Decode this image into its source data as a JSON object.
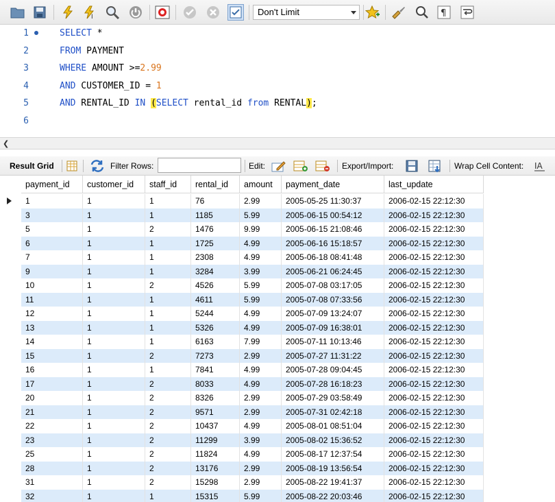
{
  "toolbar": {
    "limit_value": "Don't Limit",
    "icons": [
      "open-folder-icon",
      "save-icon",
      "execute-icon",
      "execute-current-icon",
      "explain-icon",
      "stop-icon",
      "toggle-continue-icon",
      "commit-icon",
      "rollback-icon",
      "autocommit-icon",
      "bookmark-star-icon",
      "beautify-brush-icon",
      "find-icon",
      "invisible-chars-icon",
      "wrap-icon"
    ]
  },
  "editor": {
    "line_numbers": [
      "1",
      "2",
      "3",
      "4",
      "5",
      "6"
    ],
    "lines": [
      [
        {
          "t": "SELECT",
          "c": "kw"
        },
        {
          "t": " *",
          "c": ""
        }
      ],
      [
        {
          "t": "FROM",
          "c": "kw"
        },
        {
          "t": " PAYMENT",
          "c": ""
        }
      ],
      [
        {
          "t": "WHERE",
          "c": "kw"
        },
        {
          "t": " AMOUNT >=",
          "c": ""
        },
        {
          "t": "2.99",
          "c": "num"
        }
      ],
      [
        {
          "t": "AND",
          "c": "kw"
        },
        {
          "t": " CUSTOMER_ID = ",
          "c": ""
        },
        {
          "t": "1",
          "c": "num"
        }
      ],
      [
        {
          "t": "AND",
          "c": "kw"
        },
        {
          "t": " RENTAL_ID ",
          "c": ""
        },
        {
          "t": "IN",
          "c": "kw"
        },
        {
          "t": " ",
          "c": ""
        },
        {
          "t": "(",
          "c": "hl"
        },
        {
          "t": "SELECT",
          "c": "kw"
        },
        {
          "t": " rental_id ",
          "c": ""
        },
        {
          "t": "from",
          "c": "kw"
        },
        {
          "t": " RENTAL",
          "c": ""
        },
        {
          "t": ")",
          "c": "hl"
        },
        {
          "t": ";",
          "c": ""
        }
      ],
      []
    ]
  },
  "result_bar": {
    "result_grid": "Result Grid",
    "filter_rows": "Filter Rows:",
    "edit": "Edit:",
    "export_import": "Export/Import:",
    "wrap_cell": "Wrap Cell Content:"
  },
  "grid": {
    "columns": [
      "payment_id",
      "customer_id",
      "staff_id",
      "rental_id",
      "amount",
      "payment_date",
      "last_update"
    ],
    "rows": [
      [
        "1",
        "1",
        "1",
        "76",
        "2.99",
        "2005-05-25 11:30:37",
        "2006-02-15 22:12:30"
      ],
      [
        "3",
        "1",
        "1",
        "1185",
        "5.99",
        "2005-06-15 00:54:12",
        "2006-02-15 22:12:30"
      ],
      [
        "5",
        "1",
        "2",
        "1476",
        "9.99",
        "2005-06-15 21:08:46",
        "2006-02-15 22:12:30"
      ],
      [
        "6",
        "1",
        "1",
        "1725",
        "4.99",
        "2005-06-16 15:18:57",
        "2006-02-15 22:12:30"
      ],
      [
        "7",
        "1",
        "1",
        "2308",
        "4.99",
        "2005-06-18 08:41:48",
        "2006-02-15 22:12:30"
      ],
      [
        "9",
        "1",
        "1",
        "3284",
        "3.99",
        "2005-06-21 06:24:45",
        "2006-02-15 22:12:30"
      ],
      [
        "10",
        "1",
        "2",
        "4526",
        "5.99",
        "2005-07-08 03:17:05",
        "2006-02-15 22:12:30"
      ],
      [
        "11",
        "1",
        "1",
        "4611",
        "5.99",
        "2005-07-08 07:33:56",
        "2006-02-15 22:12:30"
      ],
      [
        "12",
        "1",
        "1",
        "5244",
        "4.99",
        "2005-07-09 13:24:07",
        "2006-02-15 22:12:30"
      ],
      [
        "13",
        "1",
        "1",
        "5326",
        "4.99",
        "2005-07-09 16:38:01",
        "2006-02-15 22:12:30"
      ],
      [
        "14",
        "1",
        "1",
        "6163",
        "7.99",
        "2005-07-11 10:13:46",
        "2006-02-15 22:12:30"
      ],
      [
        "15",
        "1",
        "2",
        "7273",
        "2.99",
        "2005-07-27 11:31:22",
        "2006-02-15 22:12:30"
      ],
      [
        "16",
        "1",
        "1",
        "7841",
        "4.99",
        "2005-07-28 09:04:45",
        "2006-02-15 22:12:30"
      ],
      [
        "17",
        "1",
        "2",
        "8033",
        "4.99",
        "2005-07-28 16:18:23",
        "2006-02-15 22:12:30"
      ],
      [
        "20",
        "1",
        "2",
        "8326",
        "2.99",
        "2005-07-29 03:58:49",
        "2006-02-15 22:12:30"
      ],
      [
        "21",
        "1",
        "2",
        "9571",
        "2.99",
        "2005-07-31 02:42:18",
        "2006-02-15 22:12:30"
      ],
      [
        "22",
        "1",
        "2",
        "10437",
        "4.99",
        "2005-08-01 08:51:04",
        "2006-02-15 22:12:30"
      ],
      [
        "23",
        "1",
        "2",
        "11299",
        "3.99",
        "2005-08-02 15:36:52",
        "2006-02-15 22:12:30"
      ],
      [
        "25",
        "1",
        "2",
        "11824",
        "4.99",
        "2005-08-17 12:37:54",
        "2006-02-15 22:12:30"
      ],
      [
        "28",
        "1",
        "2",
        "13176",
        "2.99",
        "2005-08-19 13:56:54",
        "2006-02-15 22:12:30"
      ],
      [
        "31",
        "1",
        "2",
        "15298",
        "2.99",
        "2005-08-22 19:41:37",
        "2006-02-15 22:12:30"
      ],
      [
        "32",
        "1",
        "1",
        "15315",
        "5.99",
        "2005-08-22 20:03:46",
        "2006-02-15 22:12:30"
      ]
    ]
  }
}
